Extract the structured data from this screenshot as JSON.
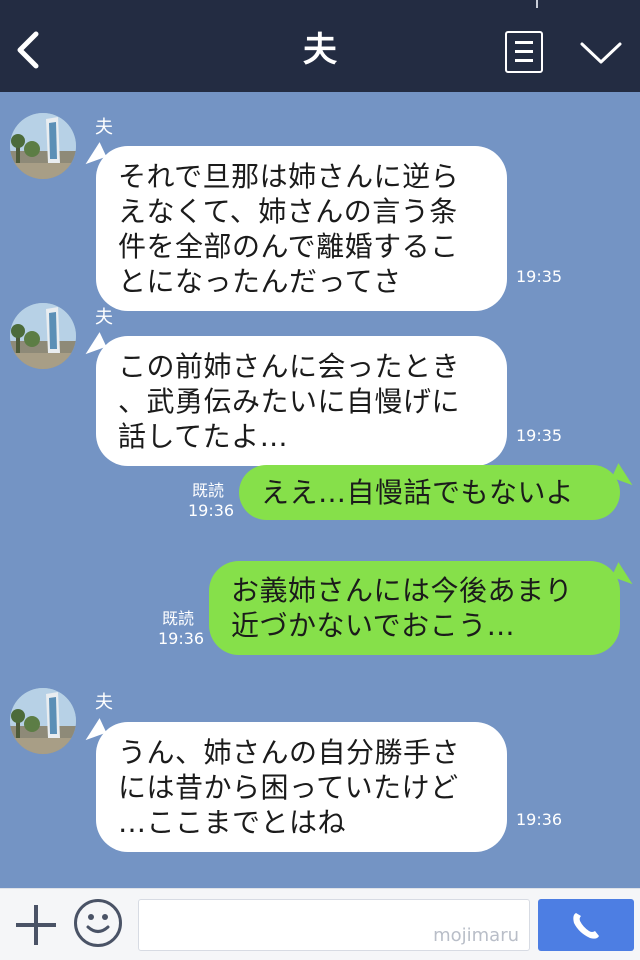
{
  "header": {
    "title": "夫"
  },
  "colors": {
    "header_bg": "#232c42",
    "chat_bg": "#7494c4",
    "incoming_bubble": "#ffffff",
    "outgoing_bubble": "#86e04a",
    "call_button": "#4d7ee3"
  },
  "icons": [
    "back-icon",
    "memo-icon",
    "chevron-down-icon",
    "plus-icon",
    "emoji-icon",
    "phone-icon"
  ],
  "messages": [
    {
      "sender": "夫",
      "lines": [
        "それで旦那は姉さんに逆ら",
        "えなくて、姉さんの言う条",
        "件を全部のんで離婚するこ",
        "とになったんだってさ"
      ],
      "time": "19:35"
    },
    {
      "sender": "夫",
      "lines": [
        "この前姉さんに会ったとき",
        "、武勇伝みたいに自慢げに",
        "話してたよ…"
      ],
      "time": "19:35"
    },
    {
      "read": "既読",
      "time": "19:36",
      "lines": [
        "ええ…自慢話でもないよ"
      ]
    },
    {
      "read": "既読",
      "time": "19:36",
      "lines": [
        "お義姉さんには今後あまり",
        "近づかないでおこう…"
      ]
    },
    {
      "sender": "夫",
      "lines": [
        "うん、姉さんの自分勝手さ",
        "には昔から困っていたけど",
        "…ここまでとはね"
      ],
      "time": "19:36"
    }
  ],
  "input": {
    "watermark": "mojimaru"
  }
}
